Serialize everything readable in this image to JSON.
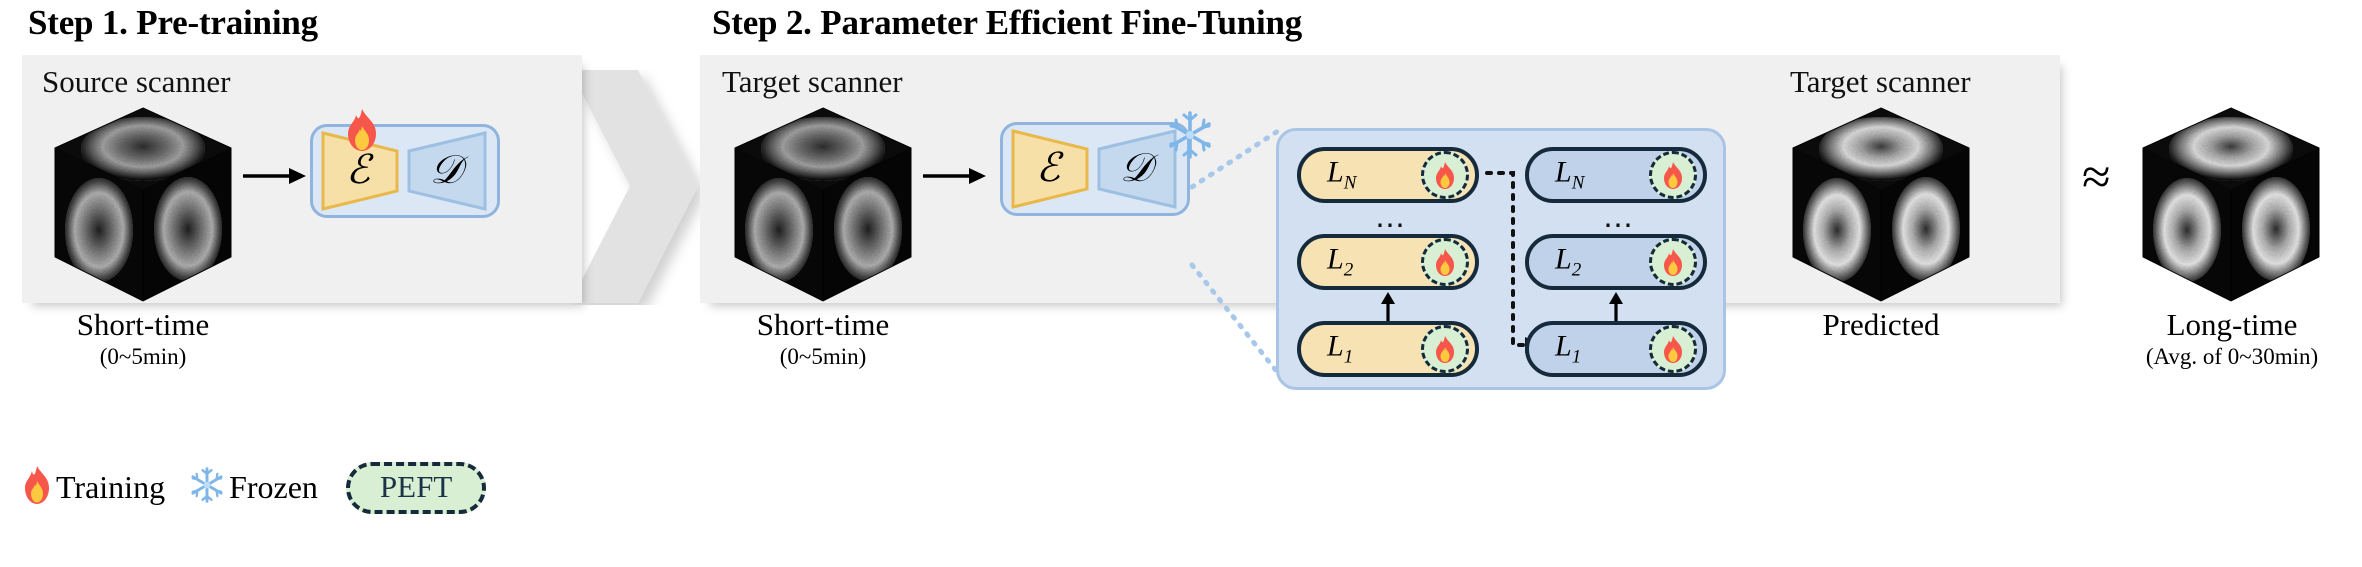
{
  "steps": {
    "step1": {
      "title": "Step 1. Pre-training",
      "scanner_label": "Source scanner",
      "caption_main": "Short-time",
      "caption_sub": "(0~5min)",
      "encoder_glyph": "ℰ",
      "decoder_glyph": "𝒟",
      "state_icon": "fire-icon"
    },
    "step2": {
      "title": "Step 2. Parameter Efficient Fine-Tuning",
      "scanner_label": "Target scanner",
      "caption_main": "Short-time",
      "caption_sub": "(0~5min)",
      "encoder_glyph": "ℰ",
      "decoder_glyph": "𝒟",
      "state_icon": "snowflake-icon",
      "output_scanner_label": "Target scanner",
      "output_caption": "Predicted"
    }
  },
  "peft_panel": {
    "left_column": [
      {
        "label": "L",
        "subscript": "N",
        "badge": "fire-icon"
      },
      {
        "label": "L",
        "subscript": "2",
        "badge": "fire-icon"
      },
      {
        "label": "L",
        "subscript": "1",
        "badge": "fire-icon"
      }
    ],
    "right_column": [
      {
        "label": "L",
        "subscript": "N",
        "badge": "fire-icon"
      },
      {
        "label": "L",
        "subscript": "2",
        "badge": "fire-icon"
      },
      {
        "label": "L",
        "subscript": "1",
        "badge": "fire-icon"
      }
    ],
    "ellipsis": "⋯"
  },
  "result": {
    "approx_symbol": "≈",
    "caption_main": "Long-time",
    "caption_sub": "(Avg. of 0~30min)"
  },
  "legend": {
    "training_icon": "fire-icon",
    "training_label": "Training",
    "frozen_icon": "snowflake-icon",
    "frozen_label": "Frozen",
    "peft_label": "PEFT"
  },
  "colors": {
    "panel_bg": "#f0f0f0",
    "ae_box_fill": "#dce7f5",
    "ae_box_border": "#8fb4dd",
    "encoder_fill": "#f7dfa8",
    "encoder_border": "#e8b84b",
    "decoder_fill": "#c4d8ee",
    "decoder_border": "#9cbfe2",
    "peft_panel_fill": "#d3e0f2",
    "layer_orange": "#f7e2b4",
    "layer_blue": "#bfd2e9",
    "layer_border": "#152b3c",
    "badge_green": "#d8efd3",
    "fire_red": "#f7574b",
    "fire_yellow": "#fcc93f",
    "snowflake_blue": "#7fb6e8",
    "chevron_gray": "#e2e2e2"
  }
}
